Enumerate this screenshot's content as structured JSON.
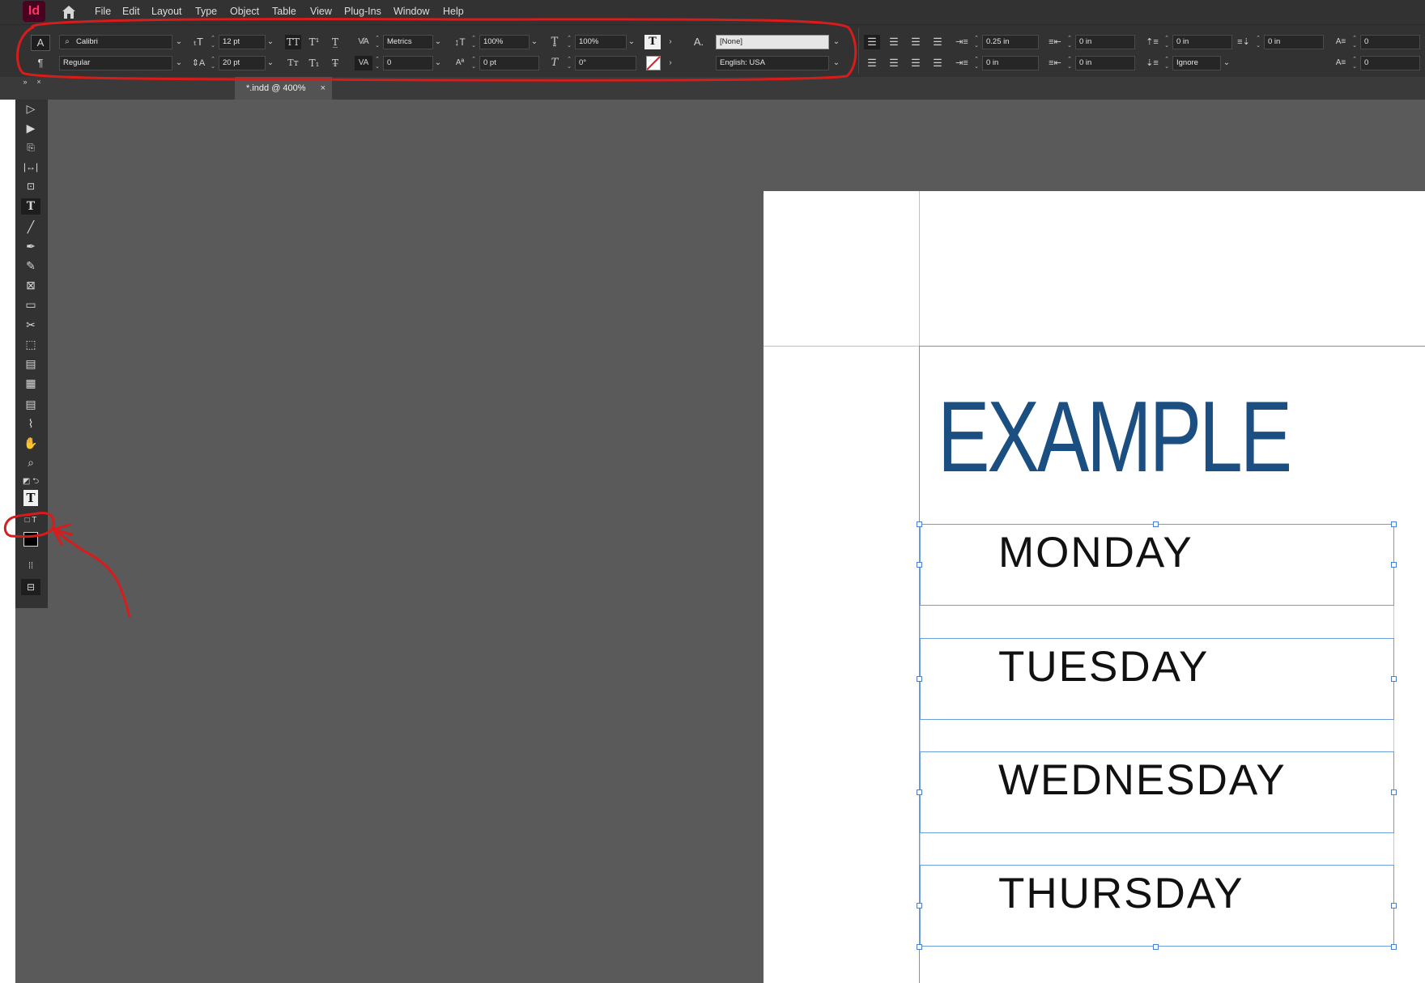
{
  "app": {
    "logo": "Id"
  },
  "menu": [
    "File",
    "Edit",
    "Layout",
    "Type",
    "Object",
    "Table",
    "View",
    "Plug-Ins",
    "Window",
    "Help"
  ],
  "control": {
    "char_mode": "A",
    "para_mode": "¶",
    "font_family": "Calibri",
    "font_style": "Regular",
    "font_size": "12 pt",
    "leading": "20 pt",
    "kerning": "Metrics",
    "tracking": "0",
    "vertical_scale": "100%",
    "horizontal_scale": "100%",
    "baseline_shift": "0 pt",
    "skew": "0°",
    "char_style": "[None]",
    "language": "English: USA",
    "left_indent": "0.25 in",
    "first_line_indent": "0 in",
    "right_indent": "0 in",
    "last_line_indent": "0 in",
    "space_before": "0 in",
    "space_after": "0 in",
    "dropcap_lines": "0",
    "dropcap_chars": "0",
    "align_grid": "Ignore"
  },
  "tab": {
    "title": "*.indd @ 400%",
    "close": "×"
  },
  "document": {
    "heading": "EXAMPLE",
    "days": [
      "MONDAY",
      "TUESDAY",
      "WEDNESDAY",
      "THURSDAY"
    ]
  },
  "colors": {
    "heading": "#1b4f82",
    "annotation": "#d81b1b",
    "frame": "#6b9ed8"
  }
}
